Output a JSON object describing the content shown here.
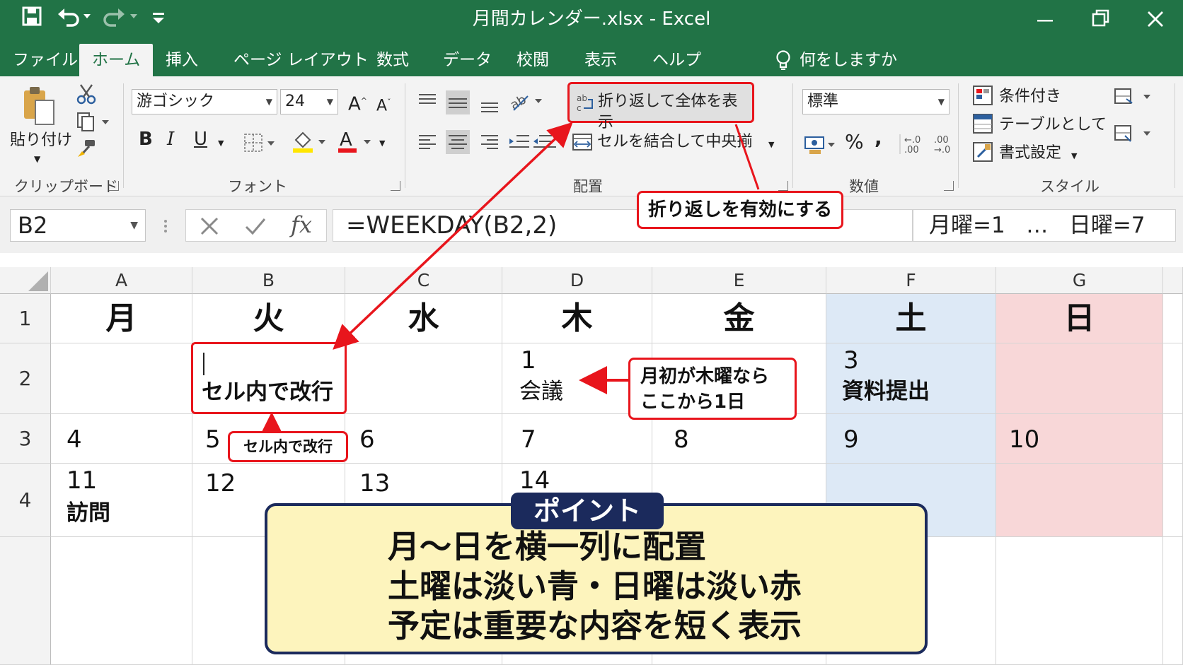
{
  "app": {
    "window_title": "月間カレンダー.xlsx  -  Excel"
  },
  "tabs": [
    "ファイル",
    "ホーム",
    "挿入",
    "ページ レイアウト",
    "数式",
    "データ",
    "校閲",
    "表示",
    "ヘルプ"
  ],
  "active_tab": "ホーム",
  "tell_me": "何をしますか",
  "ribbon": {
    "clipboard": {
      "paste_label": "貼り付け",
      "group_label": "クリップボード"
    },
    "font": {
      "font_name": "游ゴシック",
      "font_size": "24",
      "bold": "B",
      "italic": "I",
      "underline": "U",
      "font_color": "A",
      "group_label": "フォント"
    },
    "alignment": {
      "wrap_text": "折り返して全体を表示",
      "merge_center": "セルを結合して中央揃え",
      "group_label": "配置"
    },
    "number": {
      "format": "標準",
      "percent": "%",
      "comma": ",",
      "group_label": "数値"
    },
    "styles": {
      "conditional": "条件付き",
      "as_table": "テーブルとして",
      "format_label": "書式設定",
      "group_label": "スタイル"
    }
  },
  "formula_bar": {
    "name_box": "B2",
    "formula": "=WEEKDAY(B2,2)",
    "note": "月曜=1   …   日曜=7"
  },
  "sheet": {
    "columns": [
      "A",
      "B",
      "C",
      "D",
      "E",
      "F",
      "G"
    ],
    "rows": [
      "1",
      "2",
      "3",
      "4"
    ],
    "weekdays": [
      "月",
      "火",
      "水",
      "木",
      "金",
      "土",
      "日"
    ],
    "row2": {
      "d1": "1",
      "d1_event": "会議",
      "d3": "3",
      "d3_event": "資料提出",
      "b2_event": "セル内で改行"
    },
    "row3": [
      "4",
      "5",
      "6",
      "7",
      "8",
      "9",
      "10"
    ],
    "row4": {
      "a": "11",
      "a_event": "訪問",
      "b": "12",
      "c": "13",
      "d": "14"
    }
  },
  "callouts": {
    "wrap_enable": "折り返しを有効にする",
    "in_cell_break": "セル内で改行",
    "start_line1": "月初が木曜なら",
    "start_line2": "ここから1日"
  },
  "point": {
    "tag": "ポイント",
    "lines": [
      "月〜日を横一列に配置",
      "土曜は淡い青・日曜は淡い赤",
      "予定は重要な内容を短く表示"
    ]
  },
  "colors": {
    "excel_green": "#217346",
    "saturday": "#dde9f6",
    "sunday": "#f8d7d8",
    "callout_red": "#e8151c",
    "point_bg": "#fdf4bd",
    "point_border": "#1b2a5c"
  }
}
